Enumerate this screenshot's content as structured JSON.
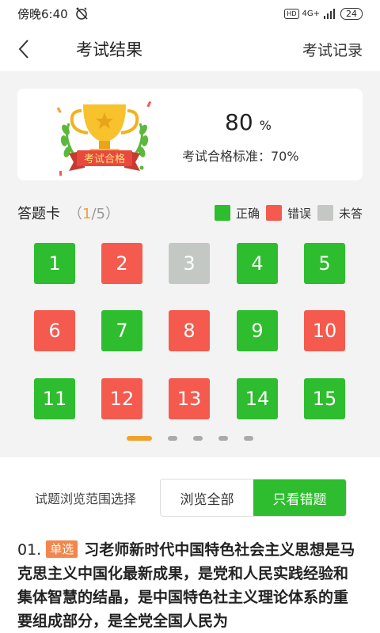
{
  "status_bar": {
    "time": "傍晚6:40",
    "network": "4G+",
    "hd": "HD",
    "battery": "24"
  },
  "nav": {
    "title": "考试结果",
    "right_link": "考试记录"
  },
  "result": {
    "badge_text": "考试合格",
    "score": "80",
    "score_unit": "%",
    "pass_standard": "考试合格标准：70%"
  },
  "answer_card": {
    "title": "答题卡",
    "page_open": "（",
    "page_current": "1",
    "page_rest": "/5）",
    "legend": [
      {
        "label": "正确",
        "color": "#2ebd2e"
      },
      {
        "label": "错误",
        "color": "#f55a4e"
      },
      {
        "label": "未答",
        "color": "#c4c8c4"
      }
    ],
    "cells": [
      {
        "num": "1",
        "status": "correct"
      },
      {
        "num": "2",
        "status": "wrong"
      },
      {
        "num": "3",
        "status": "unanswered"
      },
      {
        "num": "4",
        "status": "correct"
      },
      {
        "num": "5",
        "status": "correct"
      },
      {
        "num": "6",
        "status": "wrong"
      },
      {
        "num": "7",
        "status": "correct"
      },
      {
        "num": "8",
        "status": "wrong"
      },
      {
        "num": "9",
        "status": "correct"
      },
      {
        "num": "10",
        "status": "wrong"
      },
      {
        "num": "11",
        "status": "correct"
      },
      {
        "num": "12",
        "status": "wrong"
      },
      {
        "num": "13",
        "status": "wrong"
      },
      {
        "num": "14",
        "status": "correct"
      },
      {
        "num": "15",
        "status": "correct"
      }
    ],
    "pages": 5,
    "active_page": 1
  },
  "colors": {
    "correct": "#2ebd2e",
    "wrong": "#f55a4e",
    "unanswered": "#c4c8c4",
    "accent": "#f2a12e"
  },
  "filter": {
    "label": "试题浏览范围选择",
    "options": [
      {
        "label": "浏览全部",
        "active": false
      },
      {
        "label": "只看错题",
        "active": true
      }
    ]
  },
  "question": {
    "number": "01.",
    "type": "单选",
    "text": "习老师新时代中国特色社会主义思想是马克思主义中国化最新成果，是党和人民实践经验和集体智慧的结晶，是中国特色社主义理论体系的重要组成部分，是全党全国人民为"
  }
}
